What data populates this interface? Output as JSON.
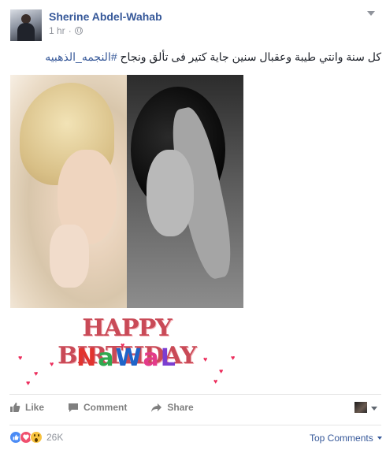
{
  "post": {
    "author": "Sherine Abdel-Wahab",
    "time": "1 hr",
    "separator": "·",
    "caption_text": "كل سنة وانتي طيبة وعقبال سنين جاية كتير فى تألق ونجاح ",
    "caption_hashtag": "#النجمه_الذهبيه",
    "image": {
      "banner_line1": "HAPPY BIRTHDAY",
      "banner_line2_letters": [
        "N",
        "a",
        "W",
        "a",
        "L"
      ],
      "banner_line2_colors": [
        "#e2342f",
        "#2fa84f",
        "#1f64c8",
        "#e33a8a",
        "#7b3ed1"
      ]
    }
  },
  "actions": {
    "like": "Like",
    "comment": "Comment",
    "share": "Share"
  },
  "reactions": {
    "types": [
      "like",
      "love",
      "wow"
    ],
    "count": "26K"
  },
  "comments": {
    "sort_label": "Top Comments"
  },
  "colors": {
    "link": "#365899",
    "meta": "#90949c",
    "action": "#7f7f7f"
  }
}
